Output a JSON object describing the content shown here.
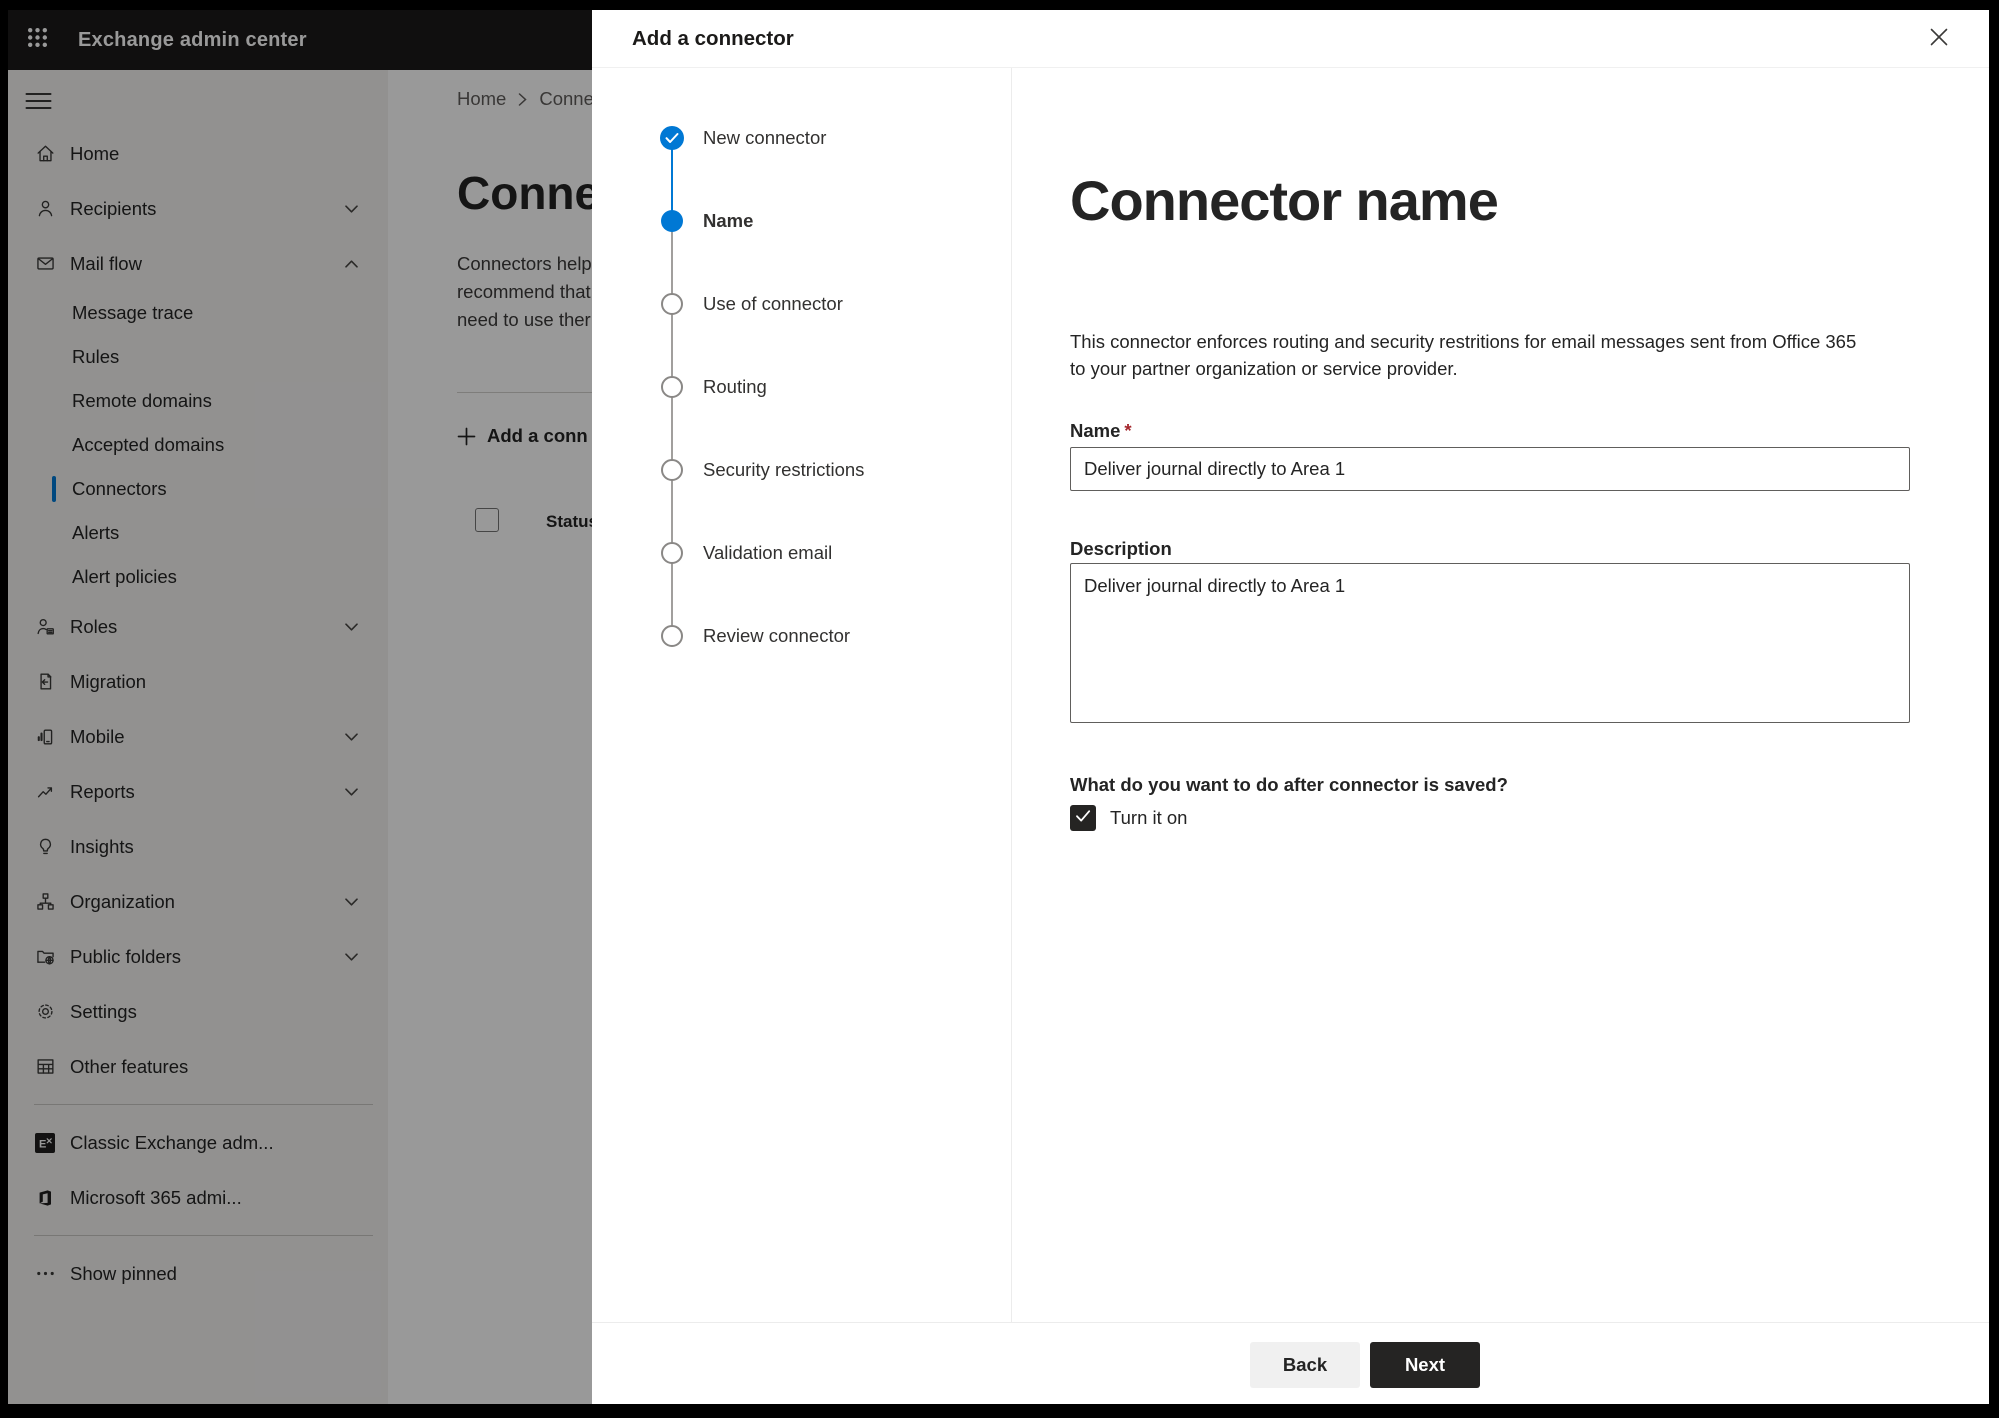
{
  "topbar": {
    "app_title": "Exchange admin center"
  },
  "sidebar": {
    "items": [
      {
        "label": "Home"
      },
      {
        "label": "Recipients",
        "expandable": true
      },
      {
        "label": "Mail flow",
        "expandable": true,
        "expanded": true
      },
      {
        "label": "Message trace"
      },
      {
        "label": "Rules"
      },
      {
        "label": "Remote domains"
      },
      {
        "label": "Accepted domains"
      },
      {
        "label": "Connectors",
        "selected": true
      },
      {
        "label": "Alerts"
      },
      {
        "label": "Alert policies"
      },
      {
        "label": "Roles",
        "expandable": true
      },
      {
        "label": "Migration"
      },
      {
        "label": "Mobile",
        "expandable": true
      },
      {
        "label": "Reports",
        "expandable": true
      },
      {
        "label": "Insights"
      },
      {
        "label": "Organization",
        "expandable": true
      },
      {
        "label": "Public folders",
        "expandable": true
      },
      {
        "label": "Settings"
      },
      {
        "label": "Other features"
      },
      {
        "label": "Classic Exchange adm..."
      },
      {
        "label": "Microsoft 365 admi..."
      },
      {
        "label": "Show pinned"
      }
    ]
  },
  "background_page": {
    "breadcrumb": {
      "home": "Home",
      "current": "Conne"
    },
    "title": "Connec",
    "intro_lines": [
      "Connectors help",
      "recommend that",
      "need to use ther"
    ],
    "add_connector_button": "Add a conn",
    "status_column": "Status"
  },
  "wizard": {
    "dialog_title": "Add a connector",
    "steps": [
      {
        "label": "New connector",
        "state": "completed"
      },
      {
        "label": "Name",
        "state": "current"
      },
      {
        "label": "Use of connector",
        "state": "upcoming"
      },
      {
        "label": "Routing",
        "state": "upcoming"
      },
      {
        "label": "Security restrictions",
        "state": "upcoming"
      },
      {
        "label": "Validation email",
        "state": "upcoming"
      },
      {
        "label": "Review connector",
        "state": "upcoming"
      }
    ],
    "page_heading": "Connector name",
    "intro_lines": [
      "This connector enforces routing and security restritions for email messages sent from Office 365",
      "to your partner organization or service provider."
    ],
    "name_field": {
      "label": "Name",
      "required_mark": "*",
      "value": "Deliver journal directly to Area 1"
    },
    "description_field": {
      "label": "Description",
      "value": "Deliver journal directly to Area 1"
    },
    "after_save": {
      "question": "What do you want to do after connector is saved?",
      "turn_on_label": "Turn it on",
      "turned_on": true
    },
    "footer": {
      "back_label": "Back",
      "next_label": "Next"
    }
  },
  "colors": {
    "accent": "#0078d4",
    "topbar_bg": "#1b1a19",
    "next_button_bg": "#252423",
    "required_red": "#a4262c",
    "sidebar_bg": "#f3f2f1"
  }
}
